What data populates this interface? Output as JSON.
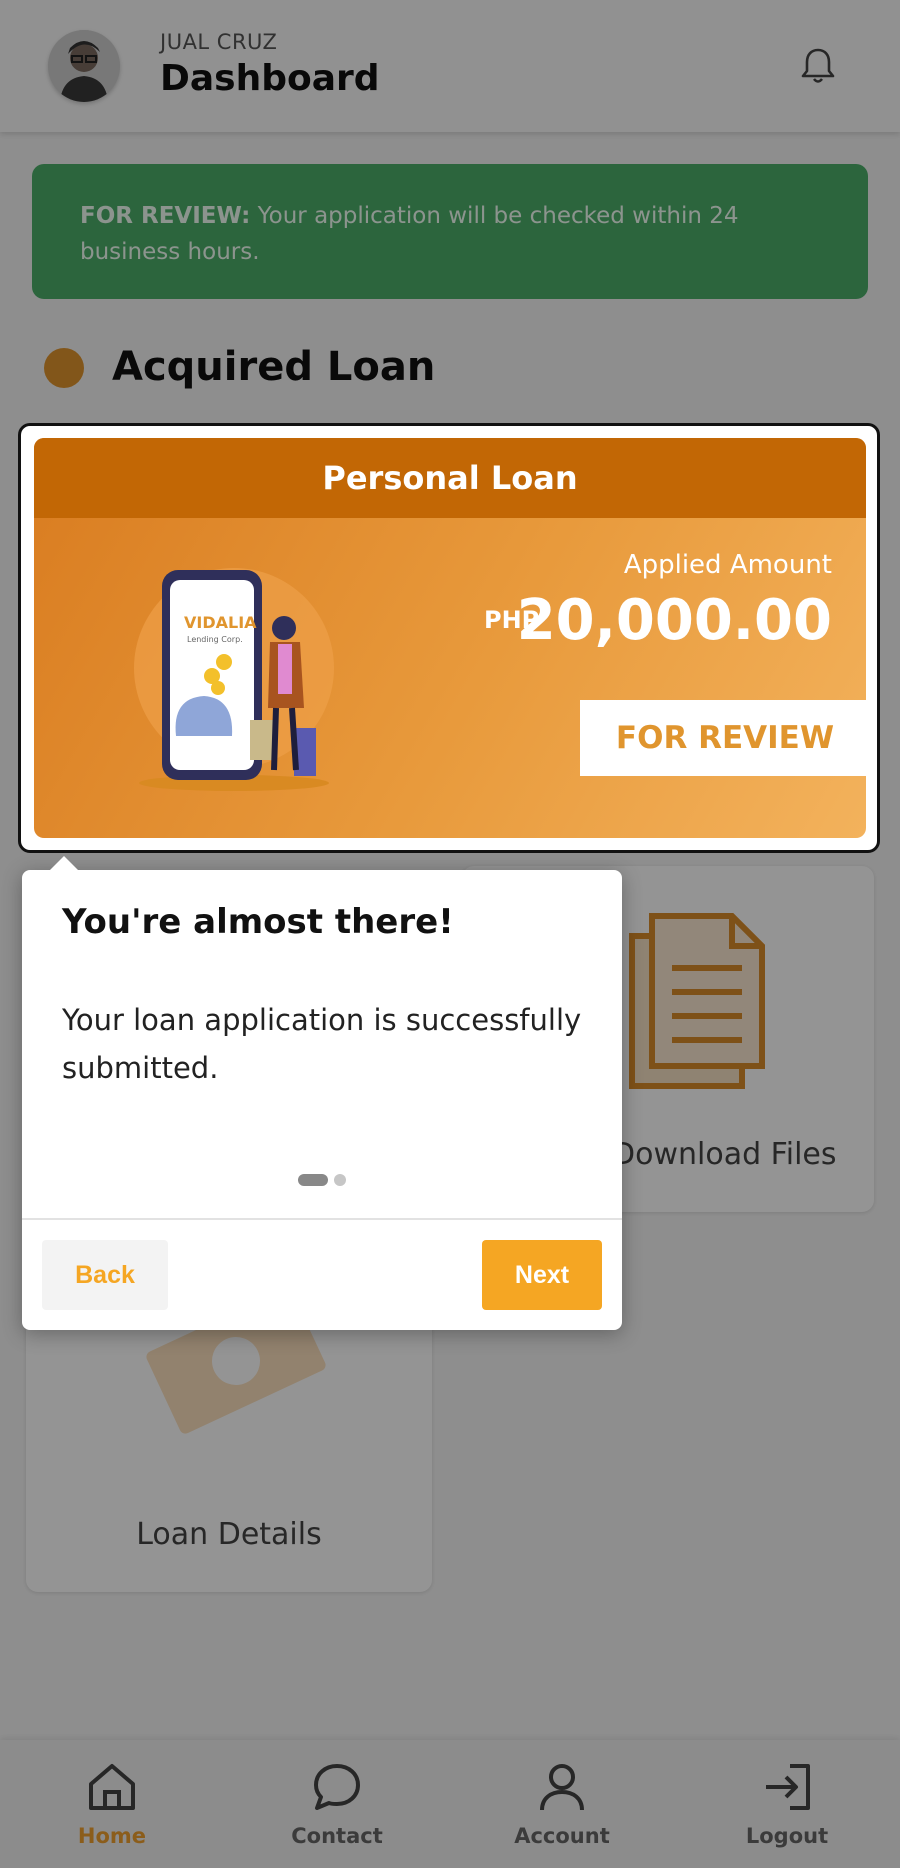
{
  "header": {
    "user_name": "JUAL CRUZ",
    "title": "Dashboard"
  },
  "alert": {
    "status_label": "FOR REVIEW:",
    "message": " Your application will be checked within 24 business hours."
  },
  "section": {
    "title": "Acquired Loan"
  },
  "loan_card": {
    "type": "Personal Loan",
    "applied_label": "Applied Amount",
    "currency": "PHP",
    "amount": "20,000.00",
    "status": "FOR REVIEW",
    "logo_text": "VIDALIA",
    "logo_subtext": "Lending Corp."
  },
  "cards": {
    "download_files_label": "Download Files",
    "loan_details_label": "Loan Details"
  },
  "popover": {
    "title": "You're almost there!",
    "body": "Your loan application is successfully submitted.",
    "back_label": "Back",
    "next_label": "Next"
  },
  "bottom_nav": {
    "home": "Home",
    "contact": "Contact",
    "account": "Account",
    "logout": "Logout"
  },
  "colors": {
    "accent": "#f5a623",
    "alert_green": "#4caf6a",
    "card_header": "#c26705"
  }
}
